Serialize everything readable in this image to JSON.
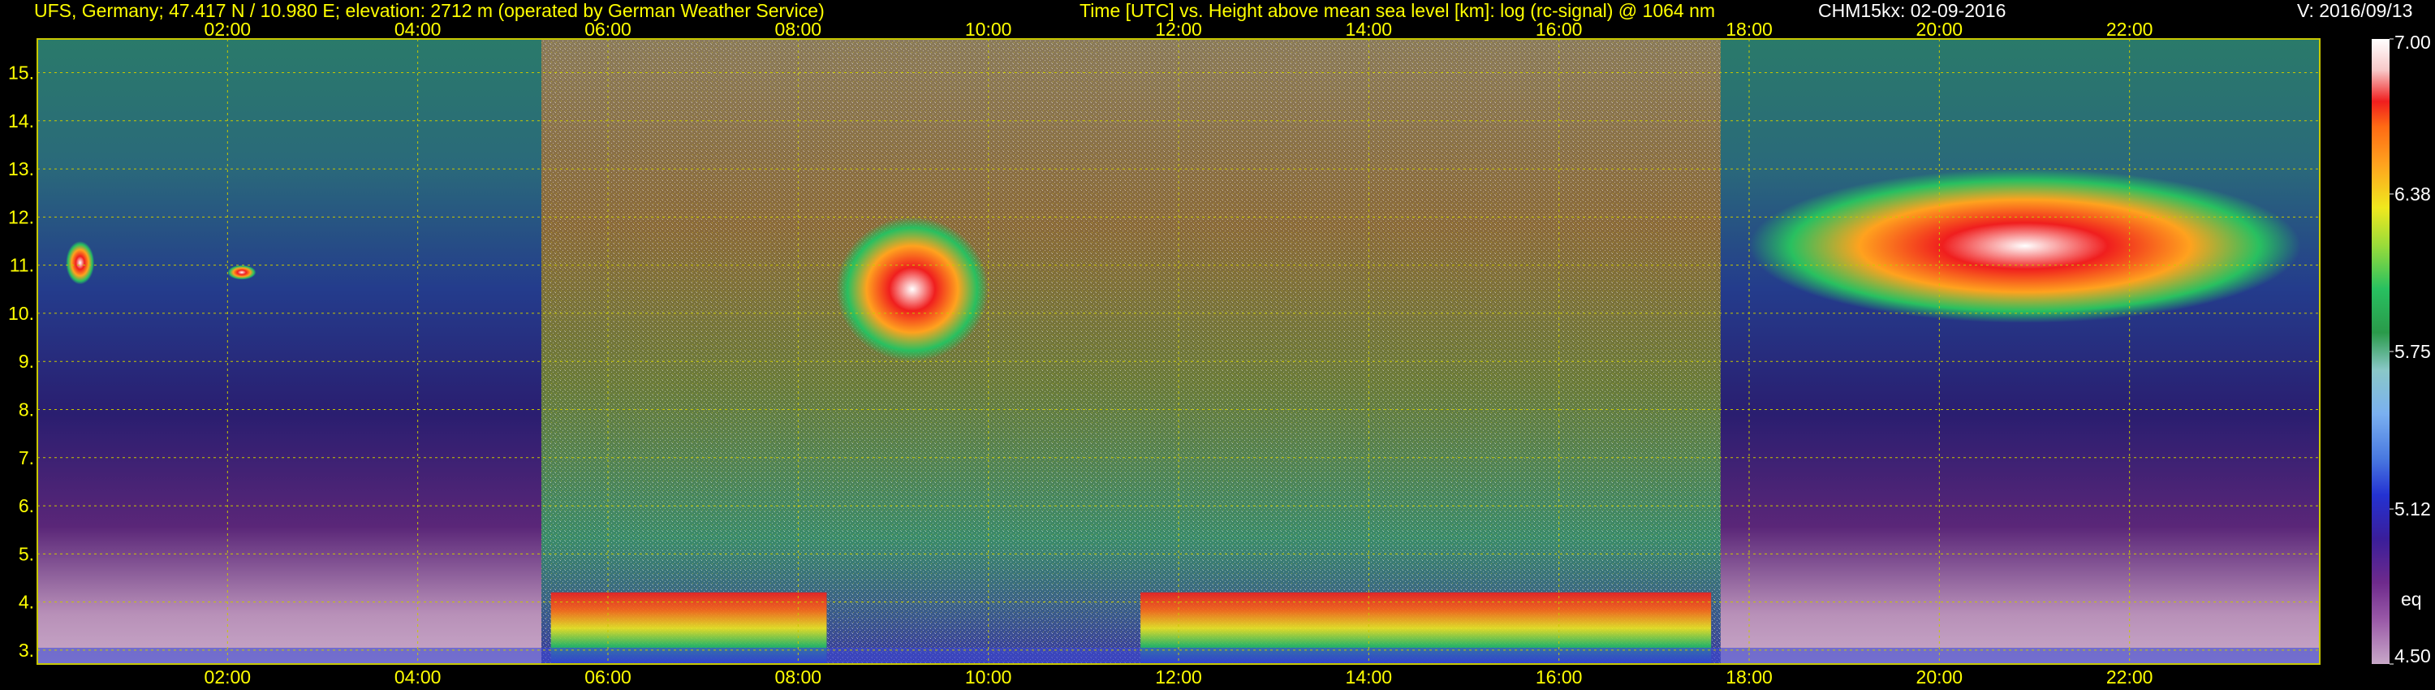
{
  "header": {
    "station": "UFS, Germany; 47.417 N / 10.980 E; elevation: 2712 m  (operated by German Weather Service)",
    "plot_title": "Time [UTC] vs. Height above mean sea level [km]: log (rc-signal) @ 1064 nm",
    "instrument": "CHM15kx: 02-09-2016",
    "version": "V: 2016/09/13"
  },
  "colors": {
    "text": "#ffff00",
    "grid": "#c8c800",
    "background": "#000000",
    "palette": [
      "#c8a8c8",
      "#6e2a8c",
      "#3a1e9a",
      "#2432d2",
      "#4a7ae0",
      "#7ab0f0",
      "#8ac8c8",
      "#2a9a4a",
      "#28c060",
      "#9adc3a",
      "#f0e81e",
      "#ffa21e",
      "#ff6a14",
      "#f01e1e",
      "#f8c8c8",
      "#ffffff"
    ]
  },
  "chart_data": {
    "type": "heatmap",
    "title": "Time [UTC] vs. Height above mean sea level [km]: log (rc-signal) @ 1064 nm",
    "xlabel": "Time [UTC]",
    "ylabel": "Height above mean sea level [km]",
    "xlim": [
      0,
      24
    ],
    "ylim": [
      2.712,
      15.7
    ],
    "x_ticks": [
      "02:00",
      "04:00",
      "06:00",
      "08:00",
      "10:00",
      "12:00",
      "14:00",
      "16:00",
      "18:00",
      "20:00",
      "22:00"
    ],
    "x_tick_values": [
      2,
      4,
      6,
      8,
      10,
      12,
      14,
      16,
      18,
      20,
      22
    ],
    "y_ticks": [
      "3.",
      "4.",
      "5.",
      "6.",
      "7.",
      "8.",
      "9.",
      "10.",
      "11.",
      "12.",
      "13.",
      "14.",
      "15."
    ],
    "y_tick_values": [
      3,
      4,
      5,
      6,
      7,
      8,
      9,
      10,
      11,
      12,
      13,
      14,
      15
    ],
    "grid": true,
    "colorbar": {
      "range": [
        4.5,
        7.0
      ],
      "tick_labels": [
        "7.00",
        "6.38",
        "5.75",
        "5.12",
        "4.50"
      ],
      "tick_values": [
        7.0,
        6.38,
        5.75,
        5.12,
        4.5
      ],
      "note": "eq"
    },
    "features": [
      {
        "kind": "daytime_noise",
        "x_start": 5.3,
        "x_end": 17.7
      },
      {
        "kind": "boundary_layer_signal",
        "x_start": 5.4,
        "x_end": 8.3,
        "y_top": 4.2
      },
      {
        "kind": "boundary_layer_signal",
        "x_start": 11.6,
        "x_end": 17.6,
        "y_top": 4.2
      },
      {
        "kind": "cirrus_cloud",
        "x_start": 8.4,
        "x_end": 10.0,
        "y_bottom": 9.0,
        "y_top": 12.0
      },
      {
        "kind": "cirrus_cloud",
        "x_start": 18.0,
        "x_end": 23.8,
        "y_bottom": 9.8,
        "y_top": 13.0
      },
      {
        "kind": "small_cloud",
        "x_start": 0.3,
        "x_end": 0.6,
        "y_bottom": 10.6,
        "y_top": 11.5
      },
      {
        "kind": "small_cloud",
        "x_start": 2.0,
        "x_end": 2.3,
        "y_bottom": 10.7,
        "y_top": 11.0
      }
    ]
  }
}
